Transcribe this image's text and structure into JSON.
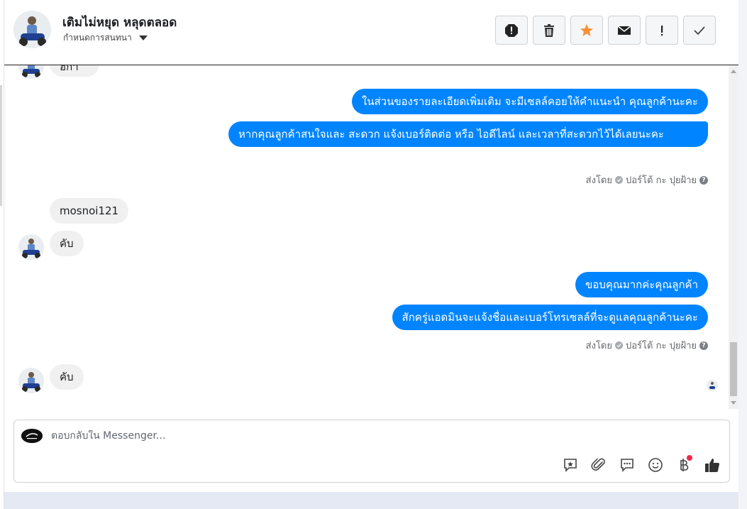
{
  "header": {
    "title": "เติมไม่หยุด หลุดตลอด",
    "subtitle": "กำหนดการสนทนา",
    "toolbar": [
      "spam-report",
      "delete",
      "star",
      "mark-unread",
      "important",
      "done"
    ]
  },
  "messages": {
    "partial_top_text": "ฮิกา",
    "out_group_1": [
      "ในส่วนของรายละเอียดเพิ่มเติม จะมีเซลล์คอยให้คำแนะนำ คุณลูกค้านะคะ",
      "หากคุณลูกค้าสนใจและ สะดวก แจ้งเบอร์ติดต่อ หรือ ไอดีไลน์ และเวลาที่สะดวกไว้ได้เลยนะคะ"
    ],
    "sent_by_1": {
      "prefix": "ส่งโดย",
      "name": "ปอร์โต้ กะ ปุยฝ้าย"
    },
    "in_group_1": [
      "mosnoi121",
      "คับ"
    ],
    "out_group_2": [
      "ขอบคุณมากค่ะคุณลูกค้า",
      "สักครู่แอดมินจะแจ้งชื่อและเบอร์โทรเซลล์ที่จะดูแลคุณลูกค้านะคะ"
    ],
    "sent_by_2": {
      "prefix": "ส่งโดย",
      "name": "ปอร์โต้ กะ ปุยฝ้าย"
    },
    "in_group_2": [
      "คับ"
    ]
  },
  "composer": {
    "placeholder": "ตอบกลับใน Messenger...",
    "icons": [
      "saved-reply-icon",
      "attachment-icon",
      "chat-bubble-icon",
      "emoji-icon",
      "baht-icon",
      "like-icon"
    ]
  },
  "colors": {
    "brand_blue": "#0084ff",
    "incoming_gray": "#f0f0f0",
    "star_orange": "#f7923a"
  }
}
